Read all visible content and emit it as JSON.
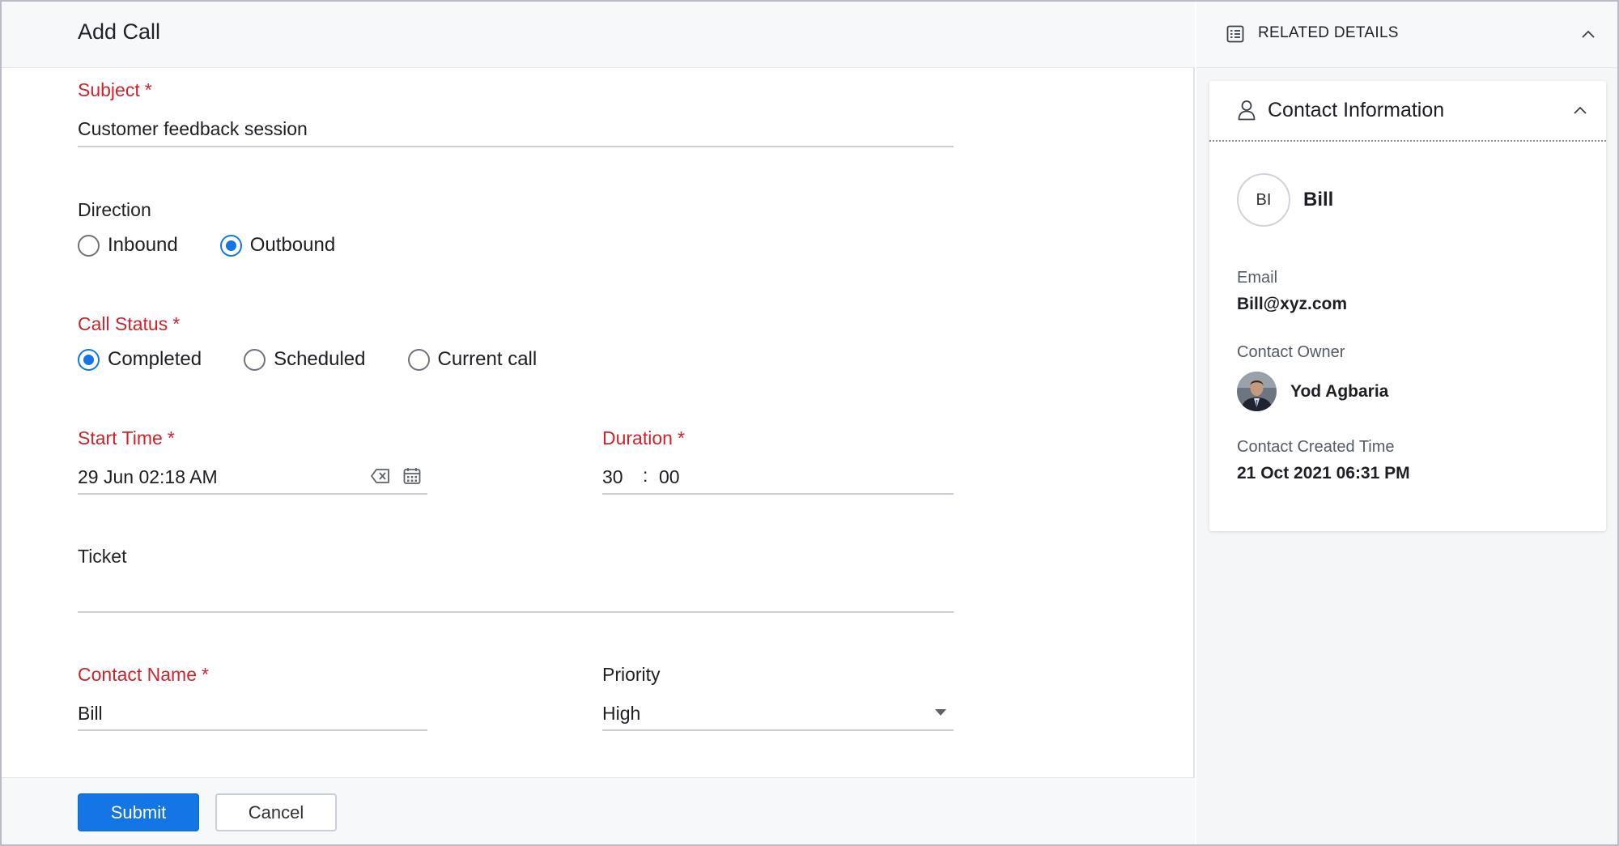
{
  "form": {
    "title": "Add Call",
    "subject": {
      "label": "Subject",
      "value": "Customer feedback session"
    },
    "direction": {
      "label": "Direction",
      "options": [
        "Inbound",
        "Outbound"
      ],
      "selected": "Outbound"
    },
    "call_status": {
      "label": "Call Status",
      "options": [
        "Completed",
        "Scheduled",
        "Current call"
      ],
      "selected": "Completed"
    },
    "start_time": {
      "label": "Start Time",
      "value": "29 Jun 02:18 AM"
    },
    "duration": {
      "label": "Duration",
      "minutes": "30",
      "separator": ":",
      "seconds": "00"
    },
    "ticket": {
      "label": "Ticket",
      "value": ""
    },
    "contact_name": {
      "label": "Contact Name",
      "value": "Bill"
    },
    "priority": {
      "label": "Priority",
      "value": "High"
    },
    "required_marker": "*"
  },
  "footer": {
    "submit_label": "Submit",
    "cancel_label": "Cancel"
  },
  "side": {
    "title": "RELATED DETAILS",
    "card": {
      "title": "Contact Information",
      "initials": "BI",
      "name": "Bill",
      "email_label": "Email",
      "email": "Bill@xyz.com",
      "owner_label": "Contact Owner",
      "owner": "Yod Agbaria",
      "created_label": "Contact Created Time",
      "created": "21 Oct 2021 06:31 PM"
    }
  },
  "colors": {
    "accent": "#1476e6",
    "required": "#d0232b"
  },
  "icons": [
    "list-details-icon",
    "chevron-up-icon",
    "user-outline-icon",
    "clear-icon",
    "calendar-icon",
    "caret-down-icon"
  ]
}
